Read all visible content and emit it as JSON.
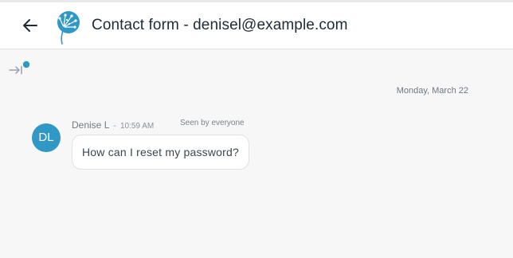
{
  "header": {
    "title": "Contact form - denisel@example.com",
    "back_icon": "arrow-left-icon",
    "logo_icon": "dandelion-logo-icon"
  },
  "toolbar": {
    "expand_icon": "expand-sidebar-icon",
    "indicator_color": "#2f98c4"
  },
  "conversation": {
    "date_label": "Monday, March 22",
    "messages": [
      {
        "sender_name": "Denise L",
        "separator": "-",
        "time": "10:59 AM",
        "seen_status": "Seen by everyone",
        "avatar_initials": "DL",
        "avatar_color": "#2f98c4",
        "text": "How can I reset my password?"
      }
    ]
  },
  "colors": {
    "accent": "#2f98c4",
    "background": "#f7f7f8",
    "header_background": "#ffffff"
  }
}
